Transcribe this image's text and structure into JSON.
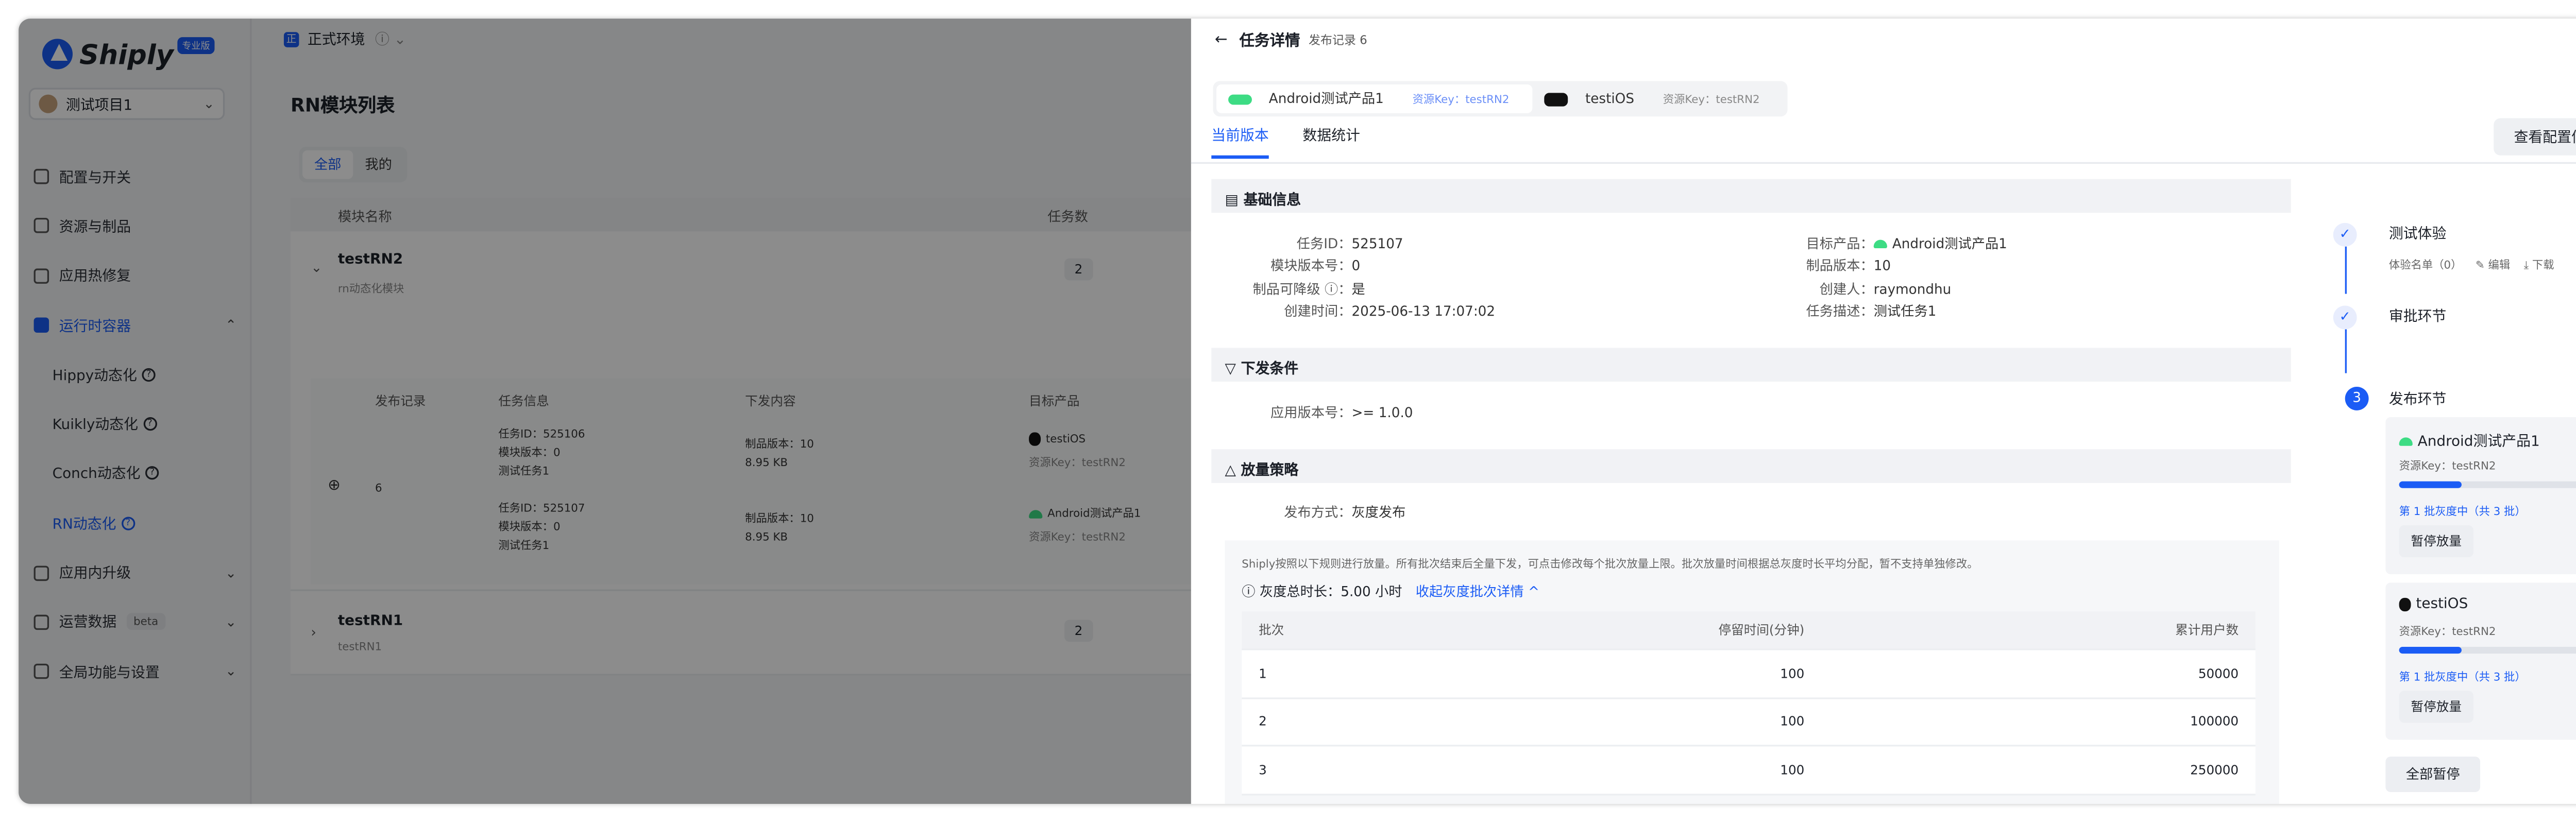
{
  "app": {
    "logo": "Shiply",
    "badge": "专业版",
    "project": "测试项目1"
  },
  "sidebar": {
    "items": [
      {
        "label": "配置与开关"
      },
      {
        "label": "资源与制品"
      },
      {
        "label": "应用热修复"
      },
      {
        "label": "运行时容器"
      },
      {
        "label": "Hippy动态化"
      },
      {
        "label": "Kuikly动态化"
      },
      {
        "label": "Conch动态化"
      },
      {
        "label": "RN动态化"
      },
      {
        "label": "应用内升级"
      },
      {
        "label": "运营数据",
        "badge": "beta"
      },
      {
        "label": "全局功能与设置"
      }
    ]
  },
  "main": {
    "env": "正式环境",
    "title": "RN模块列表",
    "filter": [
      "全部",
      "我的"
    ],
    "headers": {
      "name": "模块名称",
      "count": "任务数"
    },
    "modules": [
      {
        "name": "testRN2",
        "desc": "rn动态化模块",
        "count": "2"
      },
      {
        "name": "testRN1",
        "desc": "testRN1",
        "count": "2"
      }
    ],
    "sub_headers": [
      "发布记录",
      "任务信息",
      "下发内容",
      "目标产品"
    ],
    "sub_row": {
      "record": "6",
      "task1": "任务ID：525106",
      "ver1": "模块版本：0",
      "name1": "测试任务1",
      "task2": "任务ID：525107",
      "ver2": "模块版本：0",
      "name2": "测试任务1",
      "pv1": "制品版本：10",
      "size1": "8.95 KB",
      "pv2": "制品版本：10",
      "size2": "8.95 KB",
      "prod1": "testiOS",
      "key1": "资源Key：testRN2",
      "prod2": "Android测试产品1",
      "key2": "资源Key：testRN2"
    }
  },
  "drawer": {
    "title": "任务详情",
    "subtitle": "发布记录 6",
    "product_tabs": [
      {
        "name": "Android测试产品1",
        "key": "资源Key：testRN2"
      },
      {
        "name": "testiOS",
        "key": "资源Key：testRN2"
      }
    ],
    "view_tabs": [
      "当前版本",
      "数据统计"
    ],
    "config_button": "查看配置信息",
    "basic": {
      "title": "基础信息",
      "left": [
        {
          "k": "任务ID：",
          "v": "525107"
        },
        {
          "k": "模块版本号：",
          "v": "0"
        },
        {
          "k": "制品可降级 ⓘ：",
          "v": "是"
        },
        {
          "k": "创建时间：",
          "v": "2025-06-13 17:07:02"
        }
      ],
      "right": [
        {
          "k": "目标产品：",
          "v": "Android测试产品1"
        },
        {
          "k": "制品版本：",
          "v": "10"
        },
        {
          "k": "创建人：",
          "v": "raymondhu"
        },
        {
          "k": "任务描述：",
          "v": "测试任务1"
        }
      ]
    },
    "cond": {
      "title": "下发条件",
      "k": "应用版本号：",
      "v": ">= 1.0.0"
    },
    "strategy": {
      "title": "放量策略",
      "k": "发布方式：",
      "v": "灰度发布",
      "note": "Shiply按照以下规则进行放量。所有批次结束后全量下发，可点击修改每个批次放量上限。批次放量时间根据总灰度时长平均分配，暂不支持单独修改。",
      "duration": "灰度总时长：5.00 小时",
      "collapse": "收起灰度批次详情 ^",
      "headers": [
        "批次",
        "停留时间(分钟)",
        "累计用户数"
      ],
      "rows": [
        [
          "1",
          "100",
          "50000"
        ],
        [
          "2",
          "100",
          "100000"
        ],
        [
          "3",
          "100",
          "250000"
        ]
      ]
    },
    "steps": {
      "s1": "测试体验",
      "s1_sub": "体验名单（0）",
      "edit": "编辑",
      "download": "下载",
      "s2": "审批环节",
      "s3": "发布环节",
      "n3": "3",
      "cards": [
        {
          "name": "Android测试产品1",
          "key": "资源Key：testRN2",
          "batch": "第 1 批灰度中（共 3 批）",
          "progress": 0.33,
          "btn": "暂停放量"
        },
        {
          "name": "testiOS",
          "key": "资源Key：testRN2",
          "batch": "第 1 批灰度中（共 3 批）",
          "progress": 0.33,
          "btn": "暂停放量"
        }
      ],
      "all": "全部暂停"
    }
  },
  "colors": {
    "accent": "#1b5cf5",
    "android": "#3ddc84"
  }
}
